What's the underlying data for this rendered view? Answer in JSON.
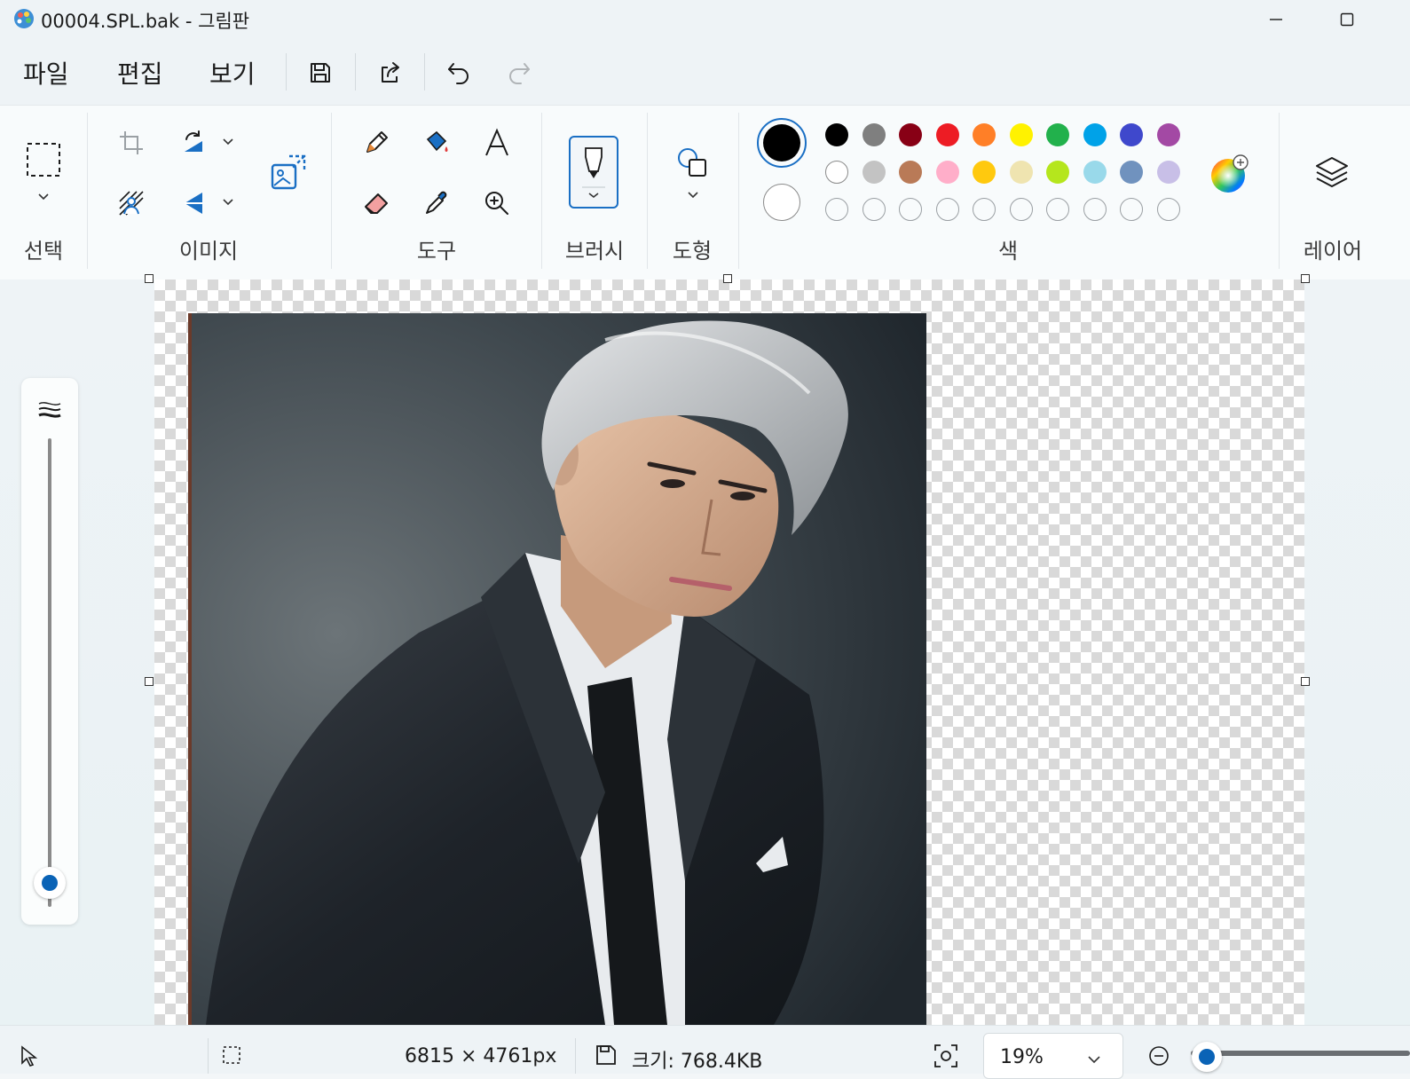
{
  "window": {
    "title": "00004.SPL.bak - 그림판"
  },
  "menu": {
    "file": "파일",
    "edit": "편집",
    "view": "보기"
  },
  "ribbon": {
    "groups": {
      "selection": "선택",
      "image": "이미지",
      "tools": "도구",
      "brushes": "브러시",
      "shapes": "도형",
      "colors": "색",
      "layers": "레이어"
    }
  },
  "colors": {
    "primary": "#000000",
    "secondary": "#ffffff",
    "palette_row1": [
      "#000000",
      "#7f7f7f",
      "#880015",
      "#ed1c24",
      "#ff7f27",
      "#fff200",
      "#22b14c",
      "#00a2e8",
      "#3f48cc",
      "#a349a4"
    ],
    "palette_row2": [
      "#ffffff",
      "#c3c3c3",
      "#b97a57",
      "#ffaec9",
      "#ffc90e",
      "#efe4b0",
      "#b5e61d",
      "#99d9ea",
      "#7092be",
      "#c8bfe7"
    ],
    "accent": "#0a63b6"
  },
  "status": {
    "dimensions": "6815 × 4761px",
    "size": "크기: 768.4KB",
    "zoom": "19%"
  }
}
